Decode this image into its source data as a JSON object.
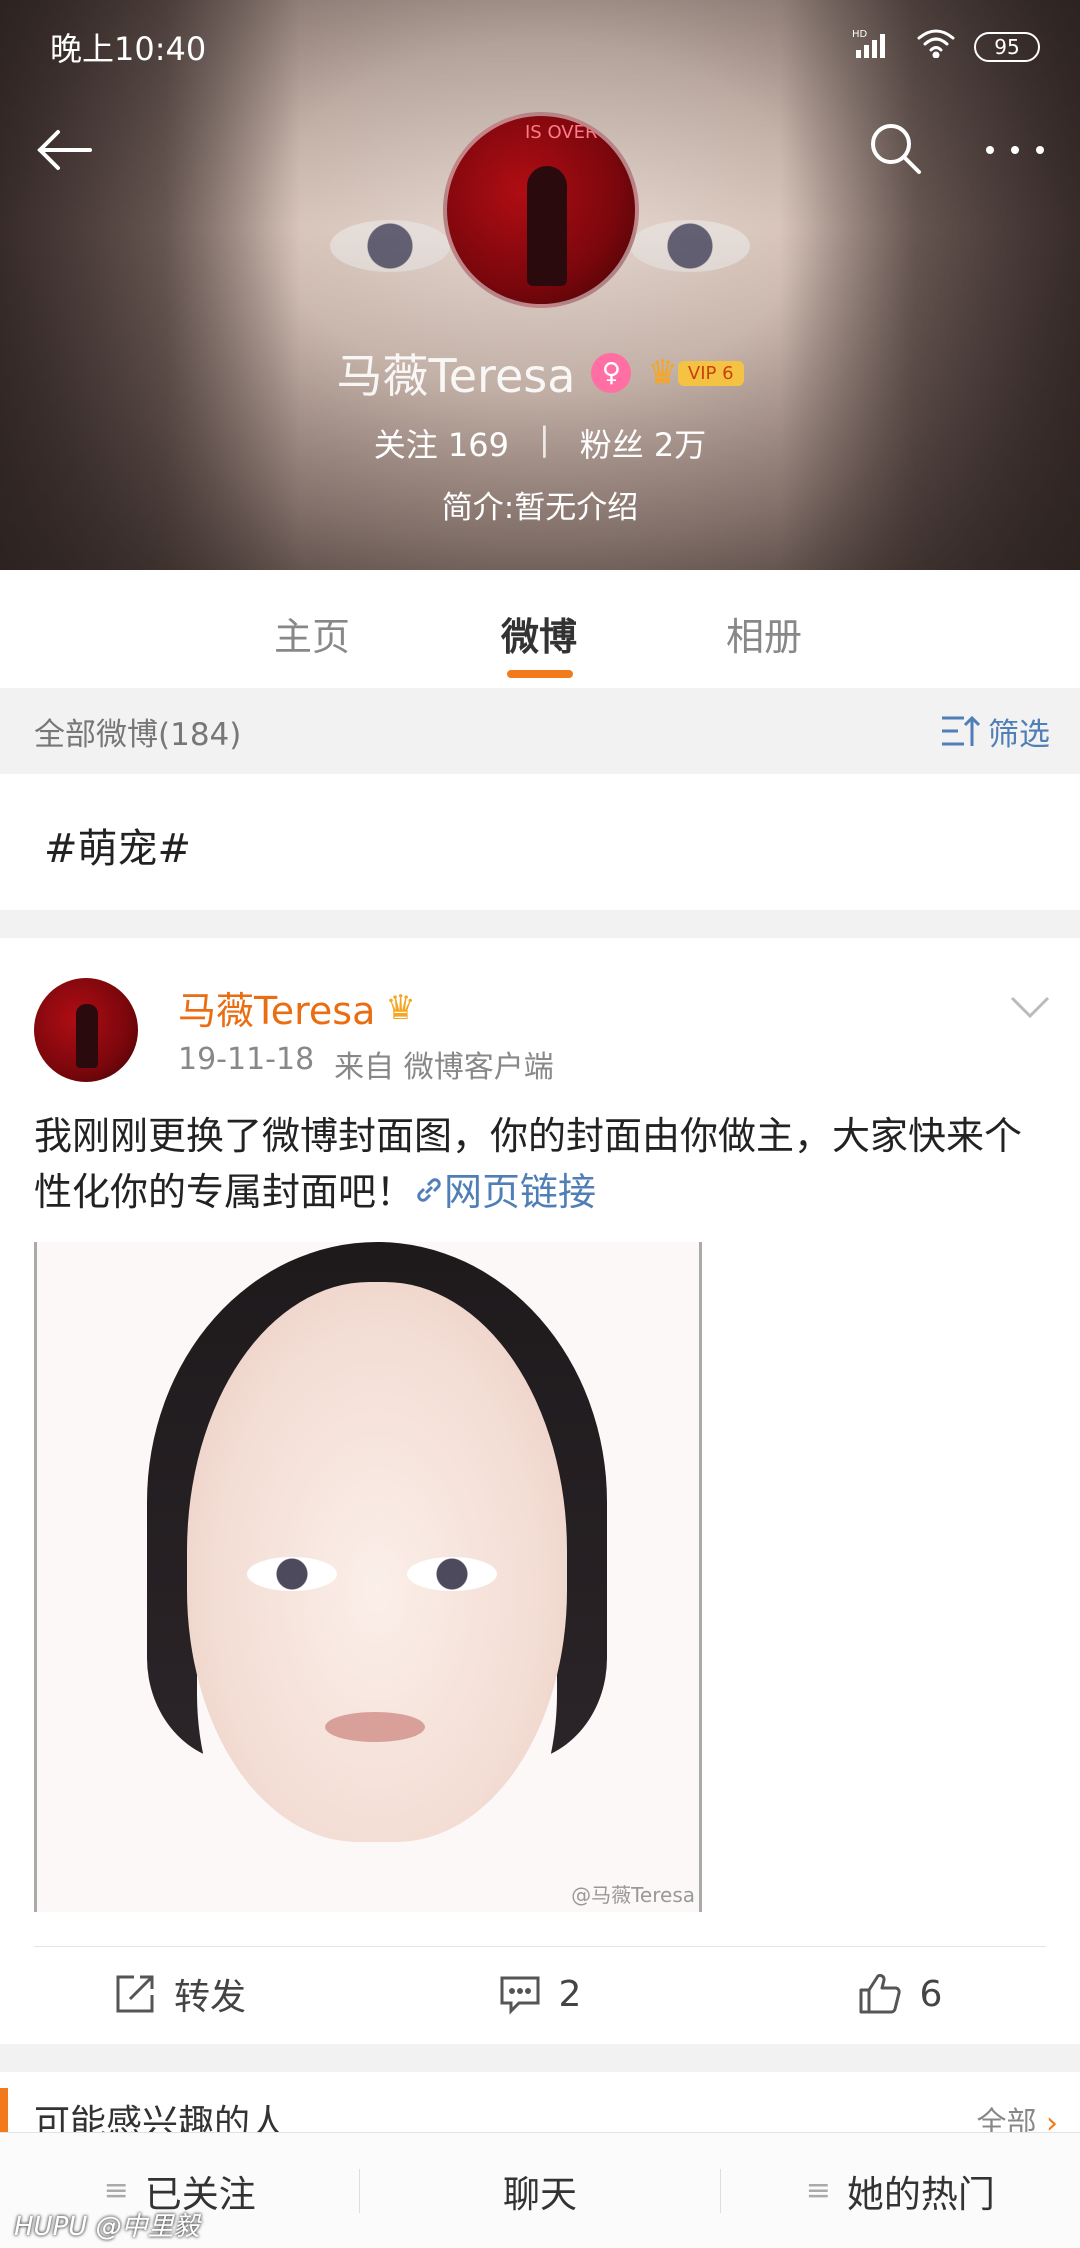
{
  "status_bar": {
    "time": "晚上10:40",
    "network": "HD",
    "battery": "95"
  },
  "profile": {
    "name": "马薇Teresa",
    "gender_badge": "♀",
    "vip_label": "VIP 6",
    "follow_label": "关注",
    "follow_count": "169",
    "fans_label": "粉丝",
    "fans_count": "2万",
    "intro": "简介:暂无介绍",
    "avatar_text": "IS OVER"
  },
  "tabs": [
    {
      "label": "主页"
    },
    {
      "label": "微博"
    },
    {
      "label": "相册"
    }
  ],
  "filter_bar": {
    "count_label": "全部微博(184)",
    "filter_label": "筛选"
  },
  "topic": "#萌宠#",
  "post": {
    "author": "马薇Teresa",
    "date": "19-11-18",
    "source": "来自 微博客户端",
    "text": "我刚刚更换了微博封面图，你的封面由你做主，大家快来个性化你的专属封面吧！",
    "link_label": "网页链接",
    "image_watermark": "@马薇Teresa",
    "repost_label": "转发",
    "comment_count": "2",
    "like_count": "6"
  },
  "suggest": {
    "title": "可能感兴趣的人",
    "all_label": "全部"
  },
  "bottom_bar": [
    {
      "label": "已关注"
    },
    {
      "label": "聊天"
    },
    {
      "label": "她的热门"
    }
  ],
  "credit": "HUPU @中里毅",
  "colors": {
    "accent": "#f27a1a",
    "link": "#4f7fb6",
    "name_orange": "#ea6d12"
  }
}
